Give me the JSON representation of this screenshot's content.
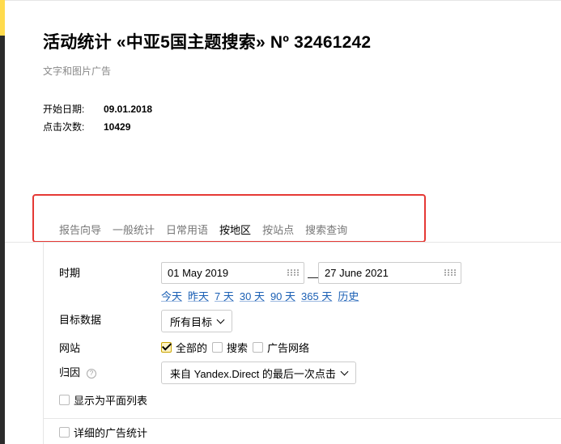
{
  "header": {
    "title": "活动统计 «中亚5国主题搜索» Nº 32461242",
    "subtitle": "文字和图片广告"
  },
  "info": {
    "start_date_label": "开始日期:",
    "start_date_value": "09.01.2018",
    "clicks_label": "点击次数:",
    "clicks_value": "10429"
  },
  "tabs": [
    {
      "label": "报告向导",
      "active": false
    },
    {
      "label": "一般统计",
      "active": false
    },
    {
      "label": "日常用语",
      "active": false
    },
    {
      "label": "按地区",
      "active": true
    },
    {
      "label": "按站点",
      "active": false
    },
    {
      "label": "搜索查询",
      "active": false
    }
  ],
  "period": {
    "label": "时期",
    "from": "01 May 2019",
    "separator": "—",
    "to": "27 June 2021",
    "quick_links": [
      "今天",
      "昨天",
      "7 天",
      "30 天",
      "90 天",
      "365 天",
      "历史"
    ]
  },
  "goals": {
    "label": "目标数据",
    "selected": "所有目标"
  },
  "site": {
    "label": "网站",
    "options": [
      {
        "label": "全部的",
        "checked": true
      },
      {
        "label": "搜索",
        "checked": false
      },
      {
        "label": "广告网络",
        "checked": false
      }
    ]
  },
  "attribution": {
    "label": "归因",
    "help_glyph": "?",
    "selected": "来自 Yandex.Direct 的最后一次点击"
  },
  "flat_list": {
    "label": "显示为平面列表",
    "checked": false
  },
  "detailed_stats": {
    "label": "详细的广告统计",
    "checked": false
  },
  "colors": {
    "accent_yellow": "#ffdb4d",
    "link_blue": "#1a5fb4",
    "highlight_red": "#e53935",
    "sidebar_dark": "#2b2b2b"
  }
}
